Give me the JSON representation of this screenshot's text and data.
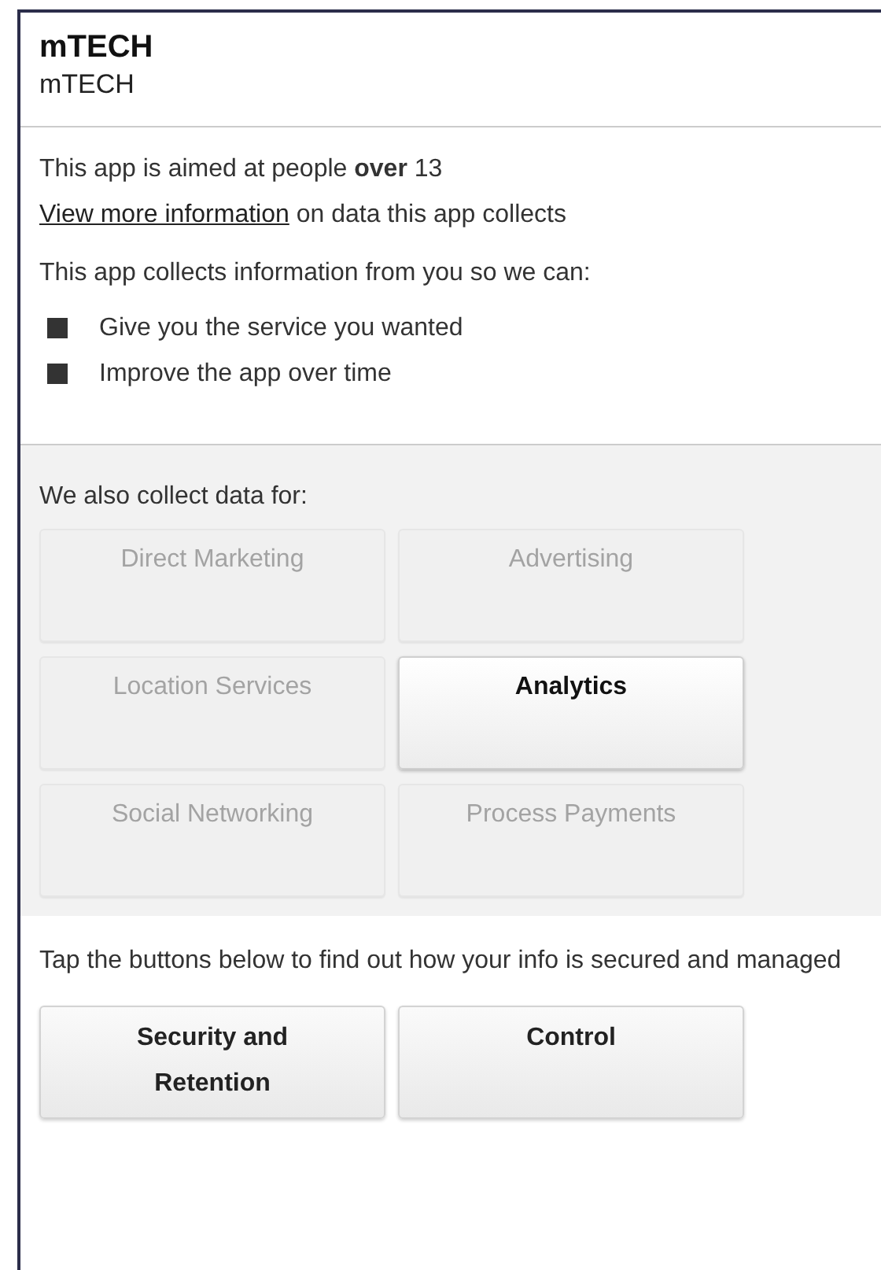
{
  "header": {
    "title": "mTECH",
    "subtitle": "mTECH"
  },
  "summary": {
    "age_notice": "This app is aimed at people **over** 13",
    "info_link": "View more information",
    "info_rest": " on data this app collects",
    "purpose_intro": "This app collects information from you so we can:",
    "purposes": [
      "Give you the service you wanted",
      "Improve the app over time"
    ]
  },
  "other_uses": {
    "heading": "We also collect data for:",
    "categories": [
      {
        "label": "Direct Marketing",
        "selected": false
      },
      {
        "label": "Advertising",
        "selected": false
      },
      {
        "label": "Location Services",
        "selected": false
      },
      {
        "label": "Analytics",
        "selected": true
      },
      {
        "label": "Social Networking",
        "selected": false
      },
      {
        "label": "Process Payments",
        "selected": false
      }
    ]
  },
  "footer": {
    "text": "Tap the buttons below to find out how your info is secured and managed",
    "buttons": [
      "Security and Retention",
      "Control"
    ]
  }
}
